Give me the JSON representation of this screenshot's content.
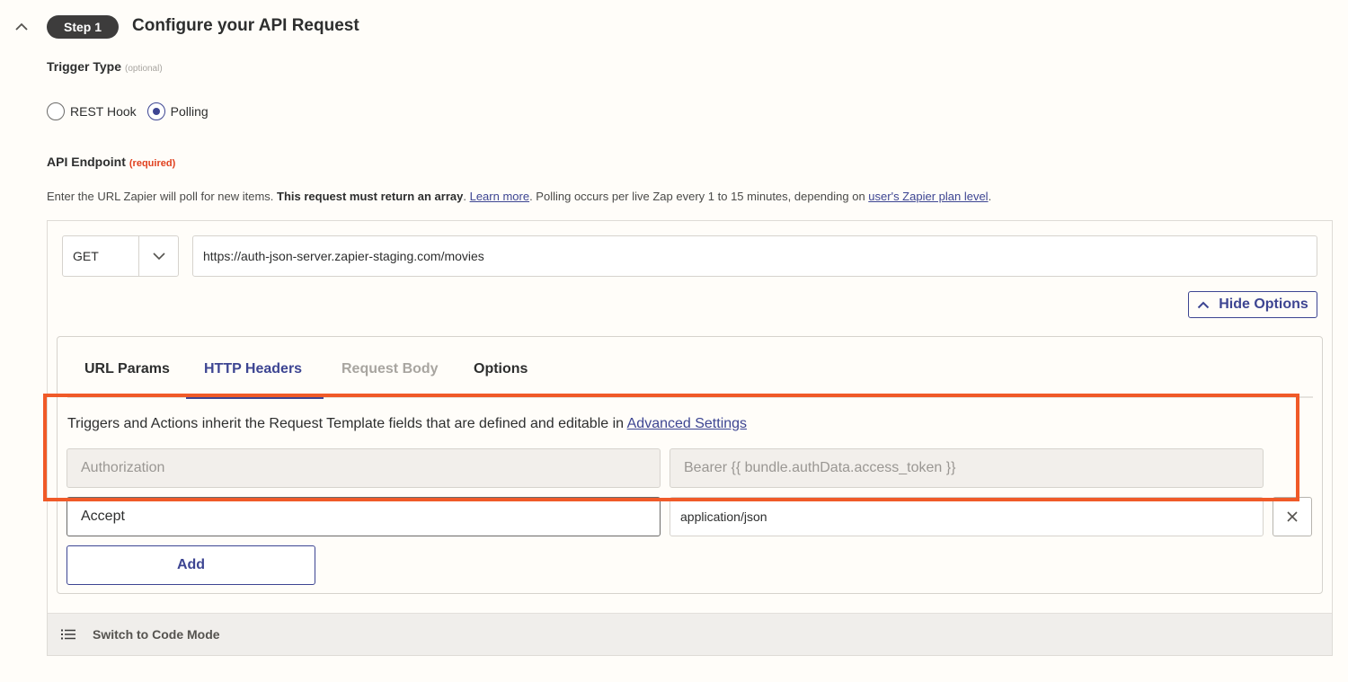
{
  "header": {
    "step_label": "Step 1",
    "title": "Configure your API Request"
  },
  "trigger_type": {
    "label": "Trigger Type",
    "optional_tag": "(optional)",
    "options": [
      {
        "label": "REST Hook",
        "selected": false
      },
      {
        "label": "Polling",
        "selected": true
      }
    ]
  },
  "api_endpoint": {
    "label": "API Endpoint",
    "required_tag": "(required)",
    "help_part1": "Enter the URL Zapier will poll for new items. ",
    "help_bold": "This request must return an array",
    "help_part2": ". ",
    "learn_more_link": "Learn more",
    "help_part3": ". Polling occurs per live Zap every 1 to 15 minutes, depending on ",
    "plan_link": "user's Zapier plan level",
    "help_part4": ".",
    "method": "GET",
    "url": "https://auth-json-server.zapier-staging.com/movies",
    "hide_options_label": "Hide Options"
  },
  "tabs": [
    {
      "label": "URL Params",
      "state": "default"
    },
    {
      "label": "HTTP Headers",
      "state": "active"
    },
    {
      "label": "Request Body",
      "state": "disabled"
    },
    {
      "label": "Options",
      "state": "default"
    }
  ],
  "headers_panel": {
    "inherit_text": "Triggers and Actions inherit the Request Template fields that are defined and editable in ",
    "advanced_settings_link": "Advanced Settings",
    "inherited_row": {
      "key": "Authorization",
      "value": "Bearer {{ bundle.authData.access_token }}"
    },
    "custom_row": {
      "key": "Accept",
      "value": "application/json"
    },
    "add_label": "Add"
  },
  "footer": {
    "code_mode_label": "Switch to Code Mode"
  },
  "colors": {
    "accent": "#3d4592",
    "highlight": "#f05a28",
    "required": "#e0401e"
  }
}
